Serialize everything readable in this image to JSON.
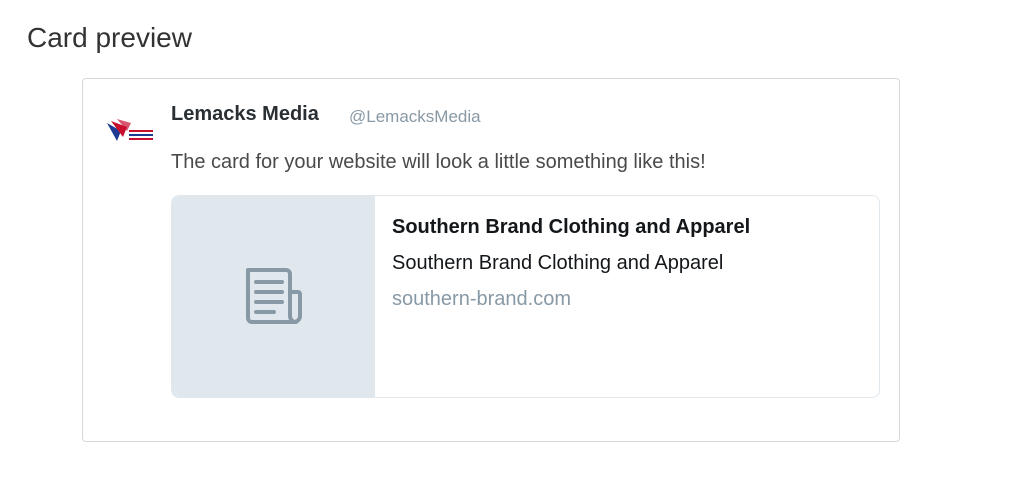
{
  "section": {
    "title": "Card preview"
  },
  "tweet": {
    "account_name": "Lemacks Media",
    "handle": "@LemacksMedia",
    "text": "The card for your website will look a little something like this!",
    "avatar_icon": "lemacks-media-logo"
  },
  "card": {
    "title": "Southern Brand Clothing and Apparel",
    "description": "Southern Brand Clothing and Apparel",
    "url": "southern-brand.com",
    "thumbnail_icon": "document-icon"
  },
  "colors": {
    "handle": "#8899a6",
    "thumb_bg": "#e1e8ed",
    "icon": "#8899a6",
    "logo_red": "#c8102e",
    "logo_blue": "#1f3a93"
  }
}
